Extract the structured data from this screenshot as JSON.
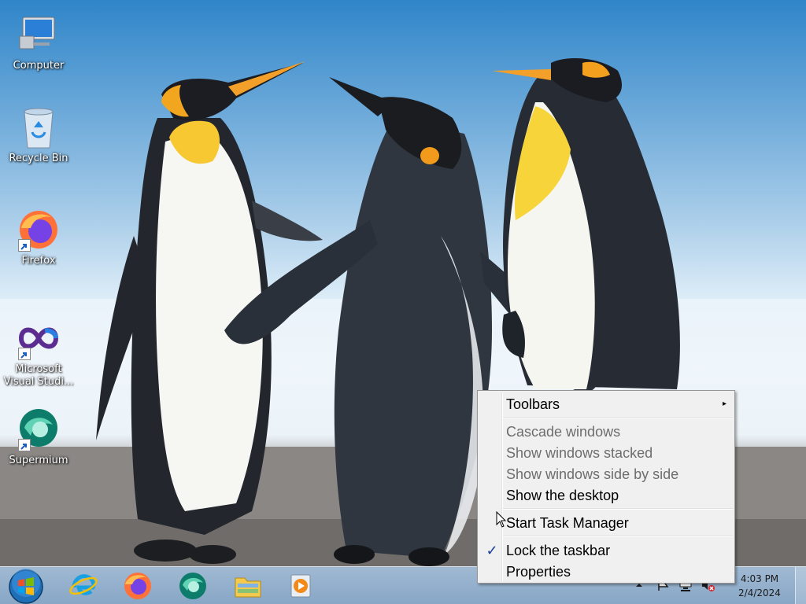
{
  "desktop": {
    "icons": [
      {
        "label": "Computer",
        "icon": "computer-icon"
      },
      {
        "label": "Recycle Bin",
        "icon": "recycle-bin-icon"
      },
      {
        "label": "Firefox",
        "icon": "firefox-icon"
      },
      {
        "label": "Microsoft\nVisual Studi...",
        "icon": "visual-studio-icon"
      },
      {
        "label": "Supermium",
        "icon": "supermium-icon"
      }
    ]
  },
  "taskbar": {
    "pinned": [
      {
        "name": "Internet Explorer",
        "icon": "internet-explorer-icon"
      },
      {
        "name": "Firefox",
        "icon": "firefox-icon"
      },
      {
        "name": "Supermium",
        "icon": "supermium-icon"
      },
      {
        "name": "File Explorer",
        "icon": "folder-icon"
      },
      {
        "name": "Media Player",
        "icon": "media-player-icon"
      }
    ],
    "clock": {
      "time": "4:03 PM",
      "date": "2/4/2024"
    }
  },
  "context_menu": {
    "items": [
      {
        "label": "Toolbars",
        "enabled": true,
        "submenu": true
      },
      {
        "label": "Cascade windows",
        "enabled": false
      },
      {
        "label": "Show windows stacked",
        "enabled": false
      },
      {
        "label": "Show windows side by side",
        "enabled": false
      },
      {
        "label": "Show the desktop",
        "enabled": true
      },
      {
        "label": "Start Task Manager",
        "enabled": true
      },
      {
        "label": "Lock the taskbar",
        "enabled": true,
        "checked": true
      },
      {
        "label": "Properties",
        "enabled": true
      }
    ],
    "check_glyph": "✓",
    "submenu_glyph": "▸"
  },
  "colors": {
    "menu_bg": "#f0f0f0",
    "disabled_text": "#6d6d6d",
    "check_color": "#1a3c9a"
  }
}
